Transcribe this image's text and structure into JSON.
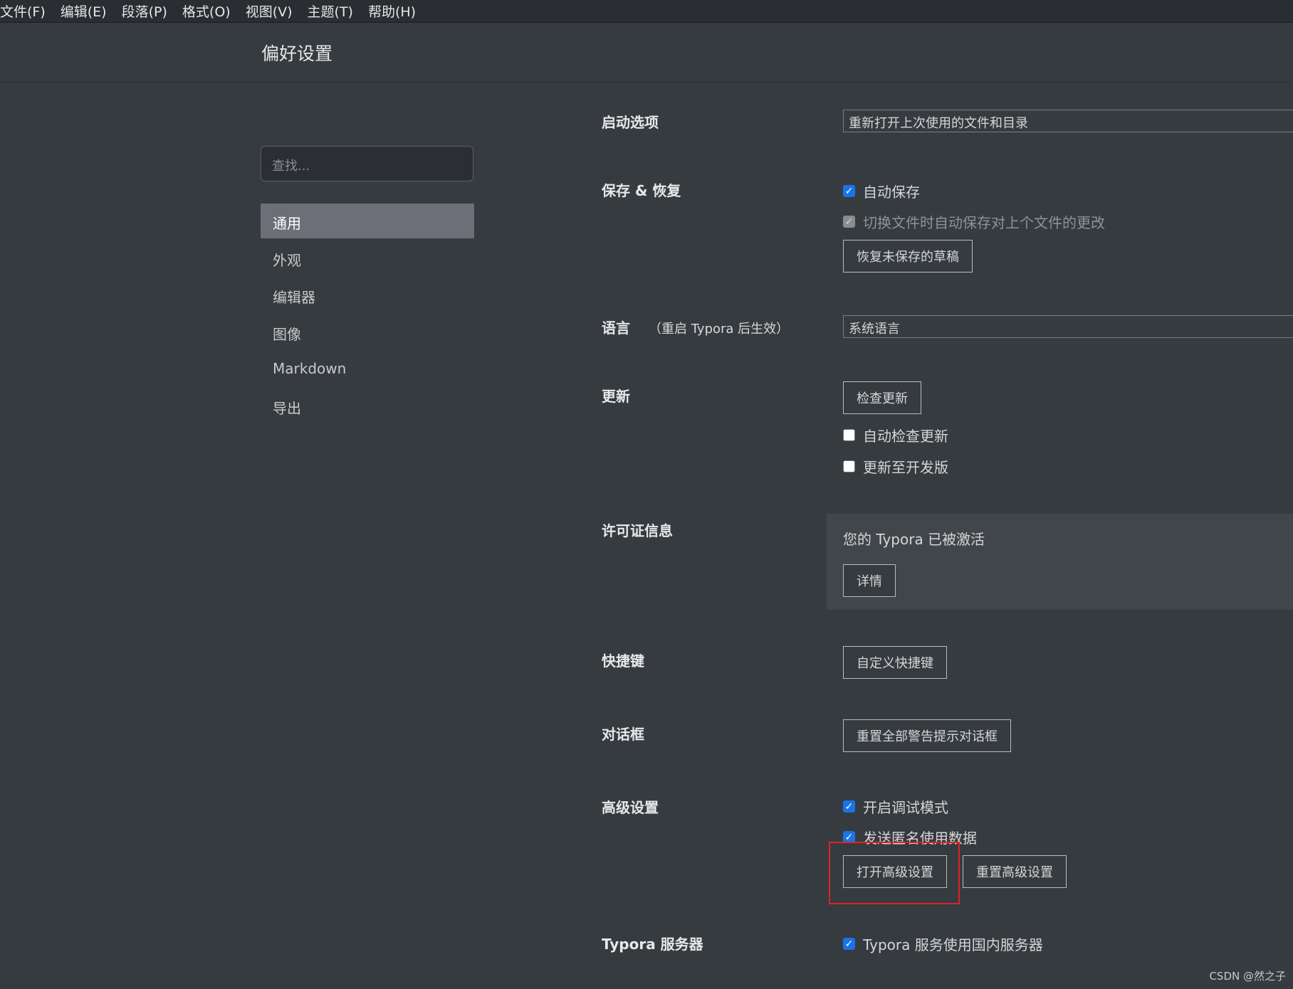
{
  "menubar": {
    "items": [
      "文件(F)",
      "编辑(E)",
      "段落(P)",
      "格式(O)",
      "视图(V)",
      "主题(T)",
      "帮助(H)"
    ]
  },
  "header": {
    "title": "偏好设置"
  },
  "sidebar": {
    "search_placeholder": "查找...",
    "items": [
      {
        "label": "通用",
        "active": true
      },
      {
        "label": "外观"
      },
      {
        "label": "编辑器"
      },
      {
        "label": "图像"
      },
      {
        "label": "Markdown"
      },
      {
        "label": "导出"
      }
    ]
  },
  "sections": {
    "startup": {
      "label": "启动选项",
      "select_value": "重新打开上次使用的文件和目录"
    },
    "save": {
      "label": "保存 & 恢复",
      "autosave": {
        "label": "自动保存",
        "checked": true
      },
      "autosave_on_switch": {
        "label": "切换文件时自动保存对上个文件的更改",
        "checked": true,
        "disabled": true
      },
      "restore_button": "恢复未保存的草稿"
    },
    "language": {
      "label": "语言",
      "note": "（重启 Typora 后生效）",
      "select_value": "系统语言"
    },
    "update": {
      "label": "更新",
      "check_button": "检查更新",
      "auto_check": {
        "label": "自动检查更新",
        "checked": false
      },
      "dev_channel": {
        "label": "更新至开发版",
        "checked": false
      }
    },
    "license": {
      "label": "许可证信息",
      "status_text": "您的 Typora 已被激活",
      "details_button": "详情"
    },
    "shortcuts": {
      "label": "快捷键",
      "button": "自定义快捷键"
    },
    "dialogs": {
      "label": "对话框",
      "button": "重置全部警告提示对话框"
    },
    "advanced": {
      "label": "高级设置",
      "debug_mode": {
        "label": "开启调试模式",
        "checked": true
      },
      "send_usage": {
        "label": "发送匿名使用数据",
        "checked": true
      },
      "open_button": "打开高级设置",
      "reset_button": "重置高级设置"
    },
    "server": {
      "label": "Typora 服务器",
      "domestic": {
        "label": "Typora 服务使用国内服务器",
        "checked": true
      }
    }
  },
  "colors": {
    "background": "#363b40",
    "accent_checkbox": "#1a73e8",
    "highlight_box": "#e0222a"
  },
  "watermark": "CSDN @然之子"
}
